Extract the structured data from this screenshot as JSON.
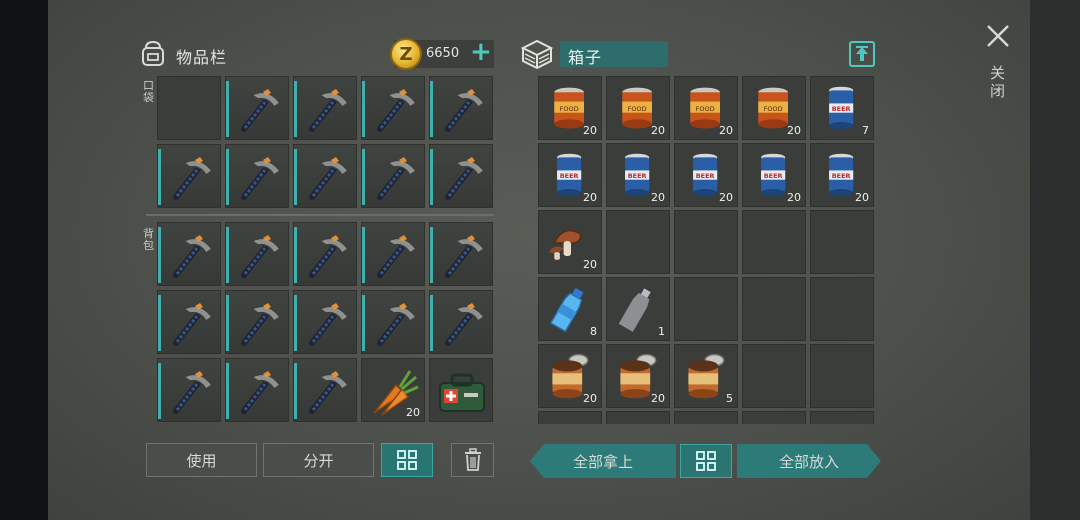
{
  "inventory": {
    "title": "物品栏",
    "coins": "6650",
    "coin_symbol": "Z",
    "plus": "+",
    "pocket_label": "口袋",
    "backpack_label": "背包",
    "pocket_slots": [
      {
        "item": "empty",
        "count": ""
      },
      {
        "item": "pickaxe",
        "count": ""
      },
      {
        "item": "pickaxe",
        "count": ""
      },
      {
        "item": "pickaxe",
        "count": ""
      },
      {
        "item": "pickaxe",
        "count": ""
      },
      {
        "item": "pickaxe",
        "count": ""
      },
      {
        "item": "pickaxe",
        "count": ""
      },
      {
        "item": "pickaxe",
        "count": ""
      },
      {
        "item": "pickaxe",
        "count": ""
      },
      {
        "item": "pickaxe",
        "count": ""
      }
    ],
    "backpack_slots": [
      {
        "item": "pickaxe",
        "count": ""
      },
      {
        "item": "pickaxe",
        "count": ""
      },
      {
        "item": "pickaxe",
        "count": ""
      },
      {
        "item": "pickaxe",
        "count": ""
      },
      {
        "item": "pickaxe",
        "count": ""
      },
      {
        "item": "pickaxe",
        "count": ""
      },
      {
        "item": "pickaxe",
        "count": ""
      },
      {
        "item": "pickaxe",
        "count": ""
      },
      {
        "item": "pickaxe",
        "count": ""
      },
      {
        "item": "pickaxe",
        "count": ""
      },
      {
        "item": "pickaxe",
        "count": ""
      },
      {
        "item": "pickaxe",
        "count": ""
      },
      {
        "item": "pickaxe",
        "count": ""
      },
      {
        "item": "carrot",
        "count": "20"
      },
      {
        "item": "medkit-bag",
        "count": ""
      }
    ],
    "buttons": {
      "use": "使用",
      "split": "分开"
    }
  },
  "chest": {
    "name": "箱子",
    "slots": [
      {
        "item": "food-can",
        "count": "20"
      },
      {
        "item": "food-can",
        "count": "20"
      },
      {
        "item": "food-can",
        "count": "20"
      },
      {
        "item": "food-can",
        "count": "20"
      },
      {
        "item": "beer-can",
        "count": "7"
      },
      {
        "item": "beer-can",
        "count": "20"
      },
      {
        "item": "beer-can",
        "count": "20"
      },
      {
        "item": "beer-can",
        "count": "20"
      },
      {
        "item": "beer-can",
        "count": "20"
      },
      {
        "item": "beer-can",
        "count": "20"
      },
      {
        "item": "mushroom",
        "count": "20"
      },
      {
        "item": "empty",
        "count": ""
      },
      {
        "item": "empty",
        "count": ""
      },
      {
        "item": "empty",
        "count": ""
      },
      {
        "item": "empty",
        "count": ""
      },
      {
        "item": "water-bottle",
        "count": "8"
      },
      {
        "item": "empty-bottle",
        "count": "1"
      },
      {
        "item": "empty",
        "count": ""
      },
      {
        "item": "empty",
        "count": ""
      },
      {
        "item": "empty",
        "count": ""
      },
      {
        "item": "open-can",
        "count": "20"
      },
      {
        "item": "open-can",
        "count": "20"
      },
      {
        "item": "open-can",
        "count": "5"
      },
      {
        "item": "empty",
        "count": ""
      },
      {
        "item": "empty",
        "count": ""
      }
    ],
    "buttons": {
      "take_all": "全部拿上",
      "put_all": "全部放入"
    }
  },
  "close_label": "关闭",
  "colors": {
    "accent": "#3fb0ad",
    "coin": "#e3b530"
  }
}
